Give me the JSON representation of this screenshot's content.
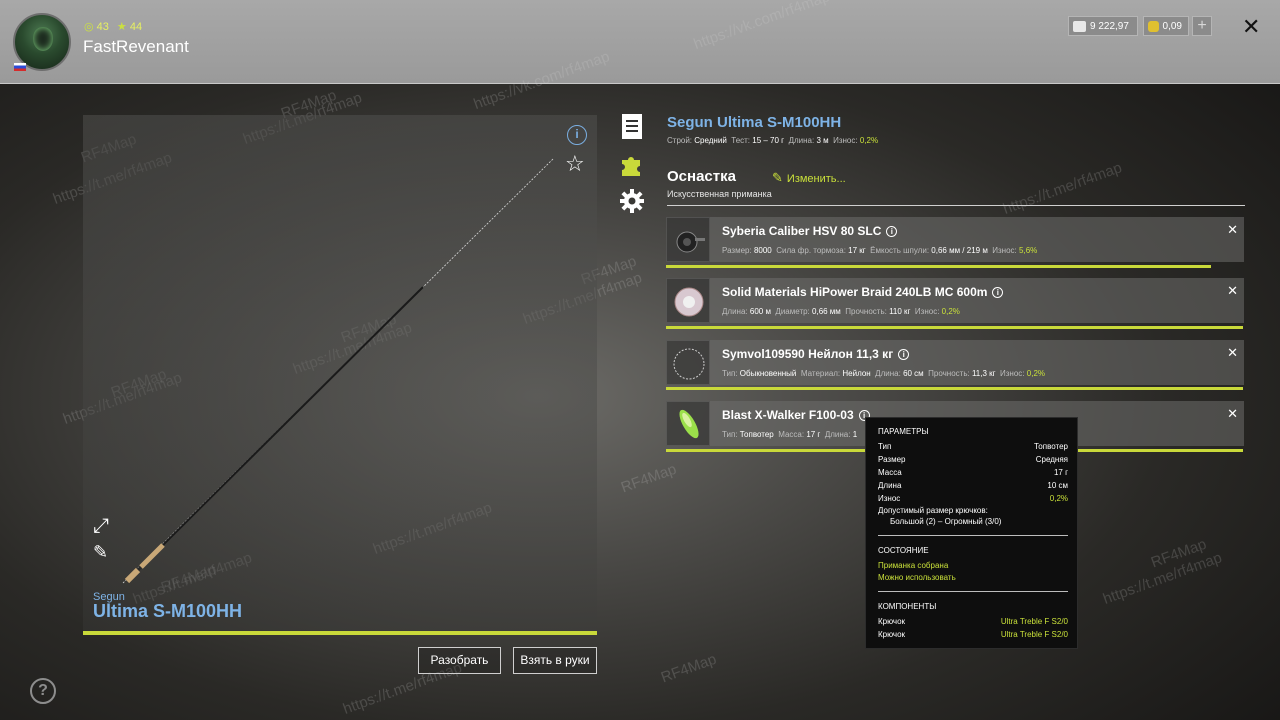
{
  "header": {
    "stat_level": "43",
    "stat_stars": "44",
    "username": "FastRevenant",
    "currency_silver": "9 222,97",
    "currency_gold": "0,09",
    "plus_label": "+",
    "close_label": "✕"
  },
  "rod_panel": {
    "brand": "Segun",
    "model": "Ultima S-M100HH",
    "button_disassemble": "Разобрать",
    "button_take": "Взять в руки"
  },
  "rod": {
    "title": "Segun Ultima S-M100HH",
    "specs": {
      "build_label": "Строй:",
      "build_value": "Средний",
      "test_label": "Тест:",
      "test_value": "15 – 70 г",
      "length_label": "Длина:",
      "length_value": "3 м",
      "wear_label": "Износ:",
      "wear_value": "0,2%"
    }
  },
  "tackle": {
    "title": "Оснастка",
    "change_label": "Изменить...",
    "subtitle": "Искусственная приманка",
    "items": [
      {
        "name": "Syberia Caliber HSV 80 SLC",
        "props": [
          {
            "k": "Размер:",
            "v": "8000"
          },
          {
            "k": "Сила фр. тормоза:",
            "v": "17 кг"
          },
          {
            "k": "Ёмкость шпули:",
            "v": "0,66 мм / 219 м"
          },
          {
            "k": "Износ:",
            "v": "5,6%",
            "hl": true
          }
        ],
        "condition": 0.946
      },
      {
        "name": "Solid Materials HiPower Braid 240LB MC 600m",
        "props": [
          {
            "k": "Длина:",
            "v": "600 м"
          },
          {
            "k": "Диаметр:",
            "v": "0,66 мм"
          },
          {
            "k": "Прочность:",
            "v": "110 кг"
          },
          {
            "k": "Износ:",
            "v": "0,2%",
            "hl": true
          }
        ],
        "condition": 1.0
      },
      {
        "name": "Symvol109590 Нейлон 11,3 кг",
        "props": [
          {
            "k": "Тип:",
            "v": "Обыкновенный"
          },
          {
            "k": "Материал:",
            "v": "Нейлон"
          },
          {
            "k": "Длина:",
            "v": "60 см"
          },
          {
            "k": "Прочность:",
            "v": "11,3 кг"
          },
          {
            "k": "Износ:",
            "v": "0,2%",
            "hl": true
          }
        ],
        "condition": 1.0
      },
      {
        "name": "Blast X-Walker F100-03",
        "props": [
          {
            "k": "Тип:",
            "v": "Топвотер"
          },
          {
            "k": "Масса:",
            "v": "17 г"
          },
          {
            "k": "Длина:",
            "v": "1"
          }
        ],
        "condition": 1.0
      }
    ]
  },
  "tooltip": {
    "params_title": "ПАРАМЕТРЫ",
    "params": [
      {
        "k": "Тип",
        "v": "Топвотер"
      },
      {
        "k": "Размер",
        "v": "Средняя"
      },
      {
        "k": "Масса",
        "v": "17 г"
      },
      {
        "k": "Длина",
        "v": "10 см"
      },
      {
        "k": "Износ",
        "v": "0,2%",
        "hl": true
      }
    ],
    "hook_size_label": "Допустимый размер крючков:",
    "hook_size_value": "Большой (2) – Огромный (3/0)",
    "state_title": "СОСТОЯНИЕ",
    "state_1": "Приманка собрана",
    "state_2": "Можно использовать",
    "components_title": "КОМПОНЕНТЫ",
    "components": [
      {
        "k": "Крючок",
        "v": "Ultra Treble F S2/0"
      },
      {
        "k": "Крючок",
        "v": "Ultra Treble F S2/0"
      }
    ]
  },
  "watermark": {
    "a": "RF4Map",
    "b": "https://vk.com/rf4map",
    "c": "https://t.me/rf4map"
  },
  "colors": {
    "accent": "#c9d93a",
    "link_blue": "#7eb3e6"
  }
}
